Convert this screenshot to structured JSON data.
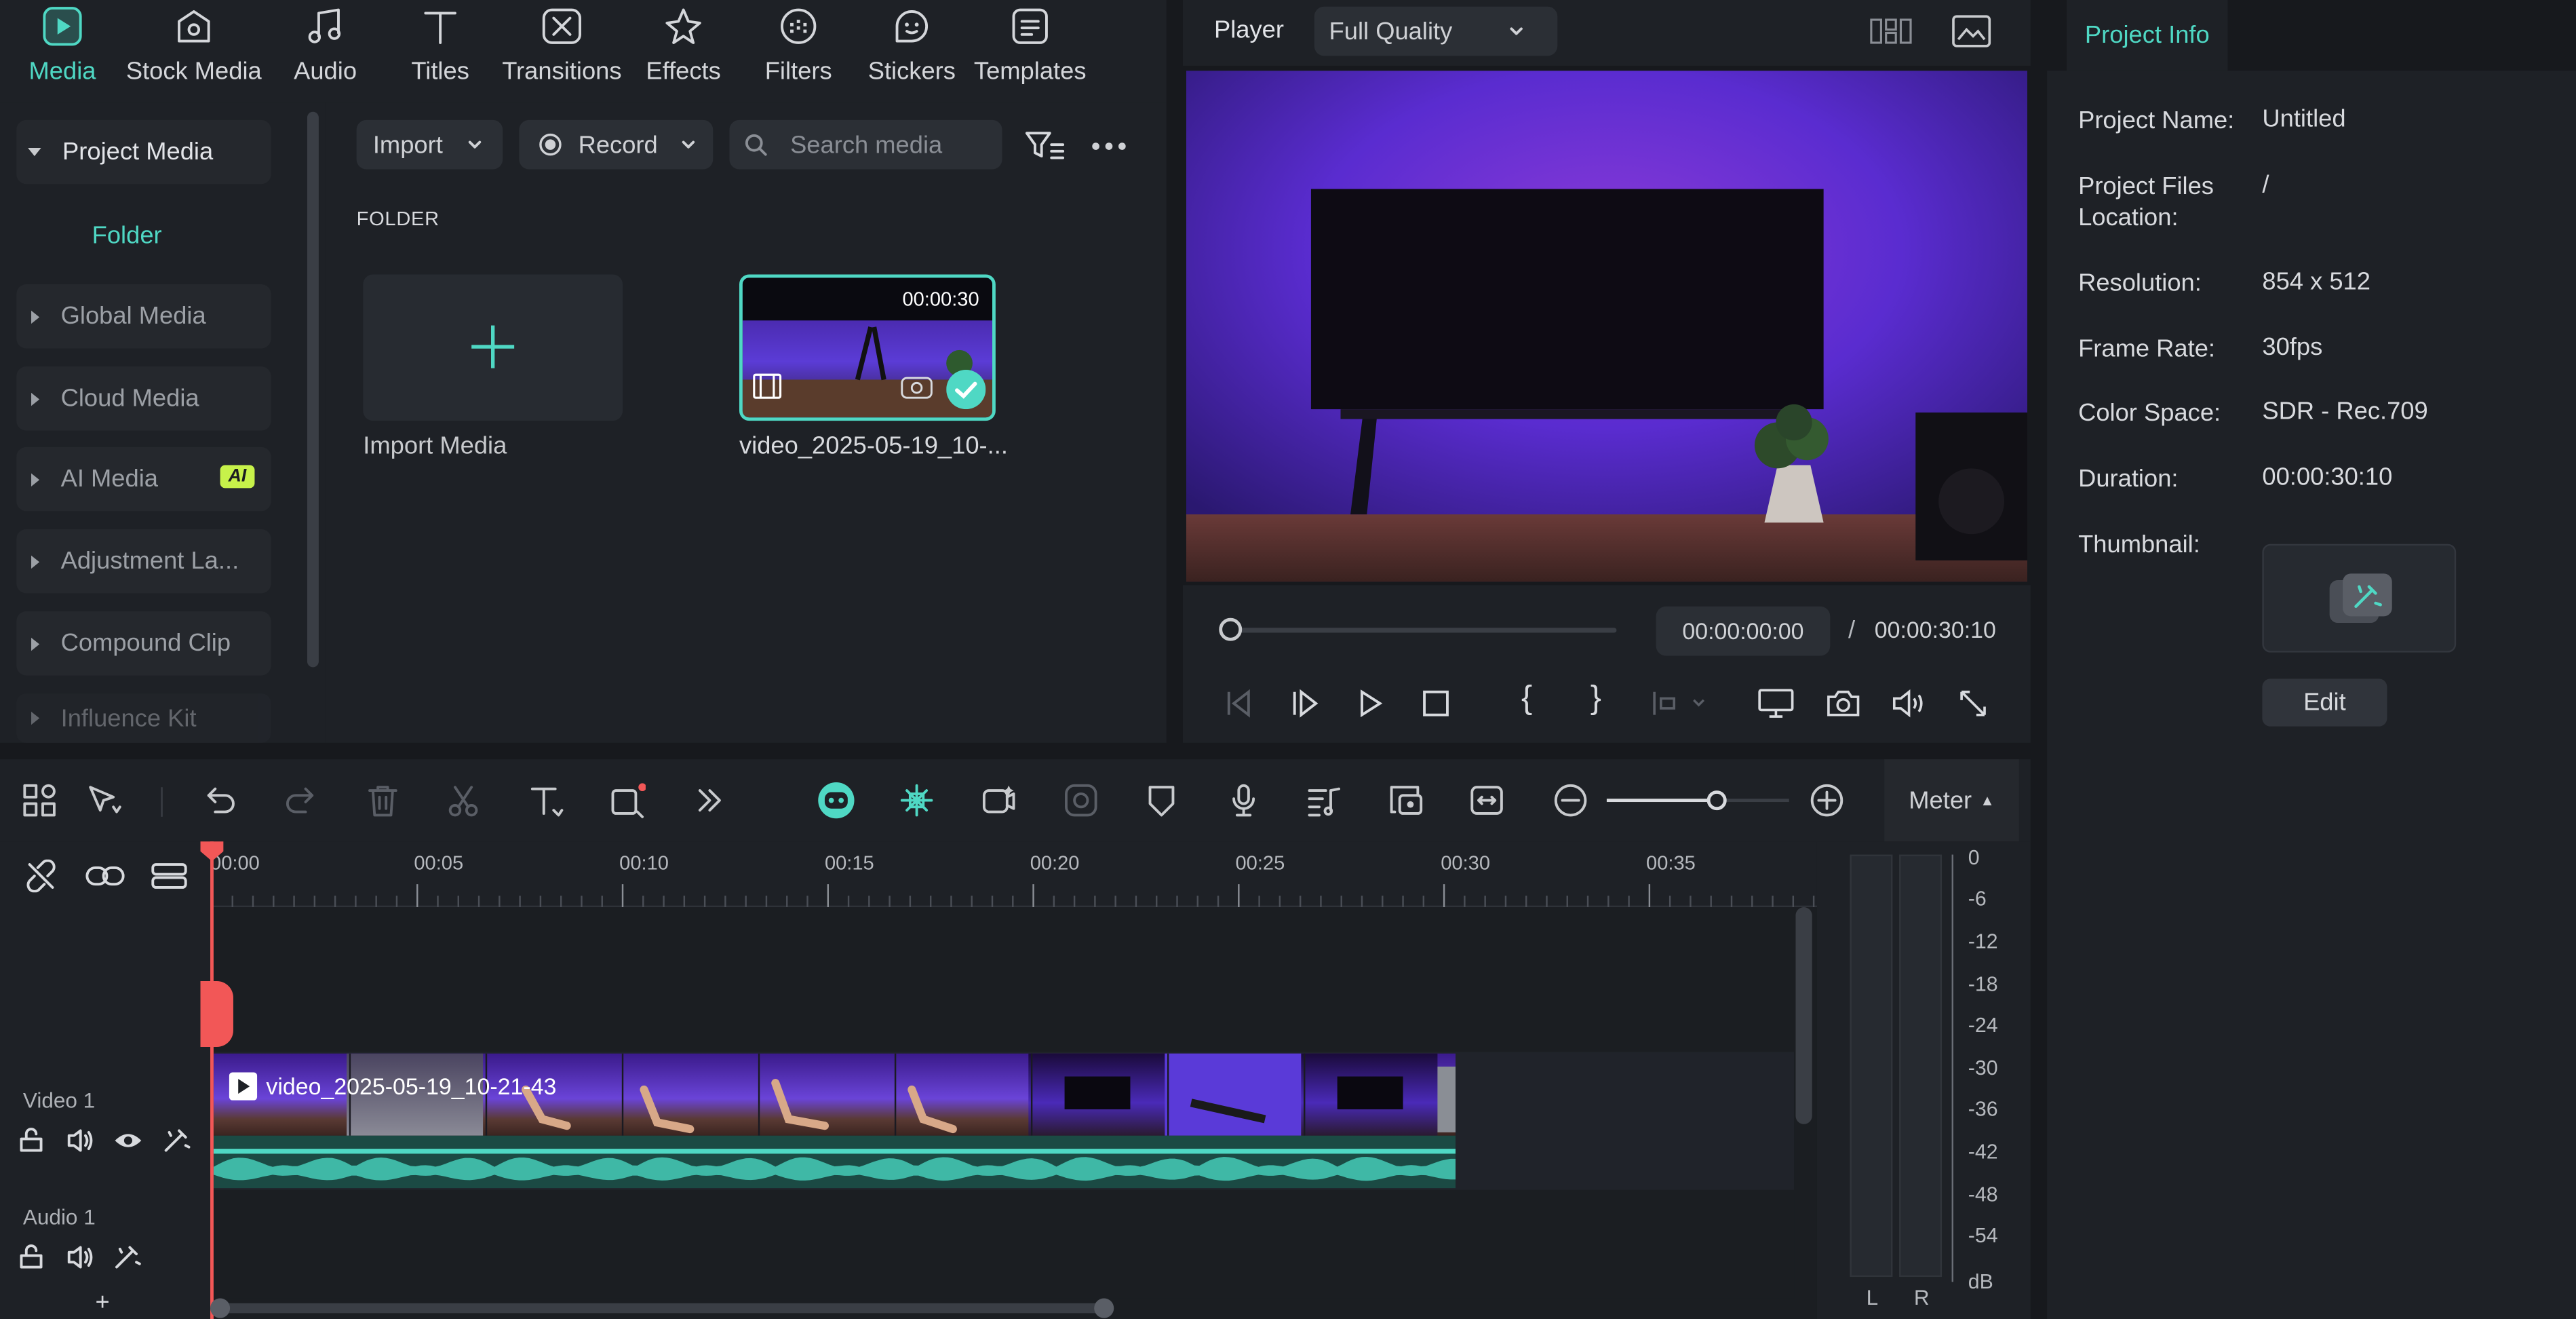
{
  "toolbar": {
    "tabs": [
      {
        "label": "Media",
        "icon": "media-icon",
        "active": true
      },
      {
        "label": "Stock Media",
        "icon": "stock-media-icon"
      },
      {
        "label": "Audio",
        "icon": "music-note-icon"
      },
      {
        "label": "Titles",
        "icon": "text-t-icon"
      },
      {
        "label": "Transitions",
        "icon": "transitions-icon"
      },
      {
        "label": "Effects",
        "icon": "effects-sparkle-icon"
      },
      {
        "label": "Filters",
        "icon": "filters-icon"
      },
      {
        "label": "Stickers",
        "icon": "stickers-icon"
      },
      {
        "label": "Templates",
        "icon": "templates-icon"
      }
    ]
  },
  "sidenav": {
    "items": [
      {
        "label": "Project Media",
        "open": true
      },
      {
        "label": "Global Media"
      },
      {
        "label": "Cloud Media"
      },
      {
        "label": "AI Media",
        "badge": "AI"
      },
      {
        "label": "Adjustment La..."
      },
      {
        "label": "Compound Clip"
      },
      {
        "label": "Influence Kit"
      }
    ],
    "folder": "Folder"
  },
  "media": {
    "import_label": "Import",
    "record_label": "Record",
    "search_placeholder": "Search media",
    "folder_heading": "FOLDER",
    "import_tile_label": "Import Media",
    "clip_duration": "00:00:30",
    "clip_name": "video_2025-05-19_10-..."
  },
  "player": {
    "label": "Player",
    "quality": "Full Quality",
    "current_time": "00:00:00:00",
    "separator": "/",
    "total_time": "00:00:30:10"
  },
  "project_info": {
    "tab": "Project Info",
    "fields": [
      {
        "key": "Project Name:",
        "value": "Untitled"
      },
      {
        "key": "Project Files Location:",
        "value": "/"
      },
      {
        "key": "Resolution:",
        "value": "854 x 512"
      },
      {
        "key": "Frame Rate:",
        "value": "30fps"
      },
      {
        "key": "Color Space:",
        "value": "SDR - Rec.709"
      },
      {
        "key": "Duration:",
        "value": "00:00:30:10"
      },
      {
        "key": "Thumbnail:",
        "value": ""
      }
    ],
    "edit_label": "Edit"
  },
  "timeline": {
    "meter_label": "Meter",
    "ruler": [
      "00:00",
      "00:05",
      "00:10",
      "00:15",
      "00:20",
      "00:25",
      "00:30",
      "00:35"
    ],
    "video_track": "Video 1",
    "audio_track": "Audio 1",
    "clip_name": "video_2025-05-19_10-21-43",
    "add_track": "+",
    "zoom_level": 0.6
  },
  "meter": {
    "ticks": [
      "0",
      "-6",
      "-12",
      "-18",
      "-24",
      "-30",
      "-36",
      "-42",
      "-48",
      "-54",
      "dB"
    ],
    "left": "L",
    "right": "R"
  },
  "colors": {
    "accent": "#4fd8c4",
    "playhead": "#f25757",
    "background": "#17191d",
    "panel": "#1e2126"
  }
}
